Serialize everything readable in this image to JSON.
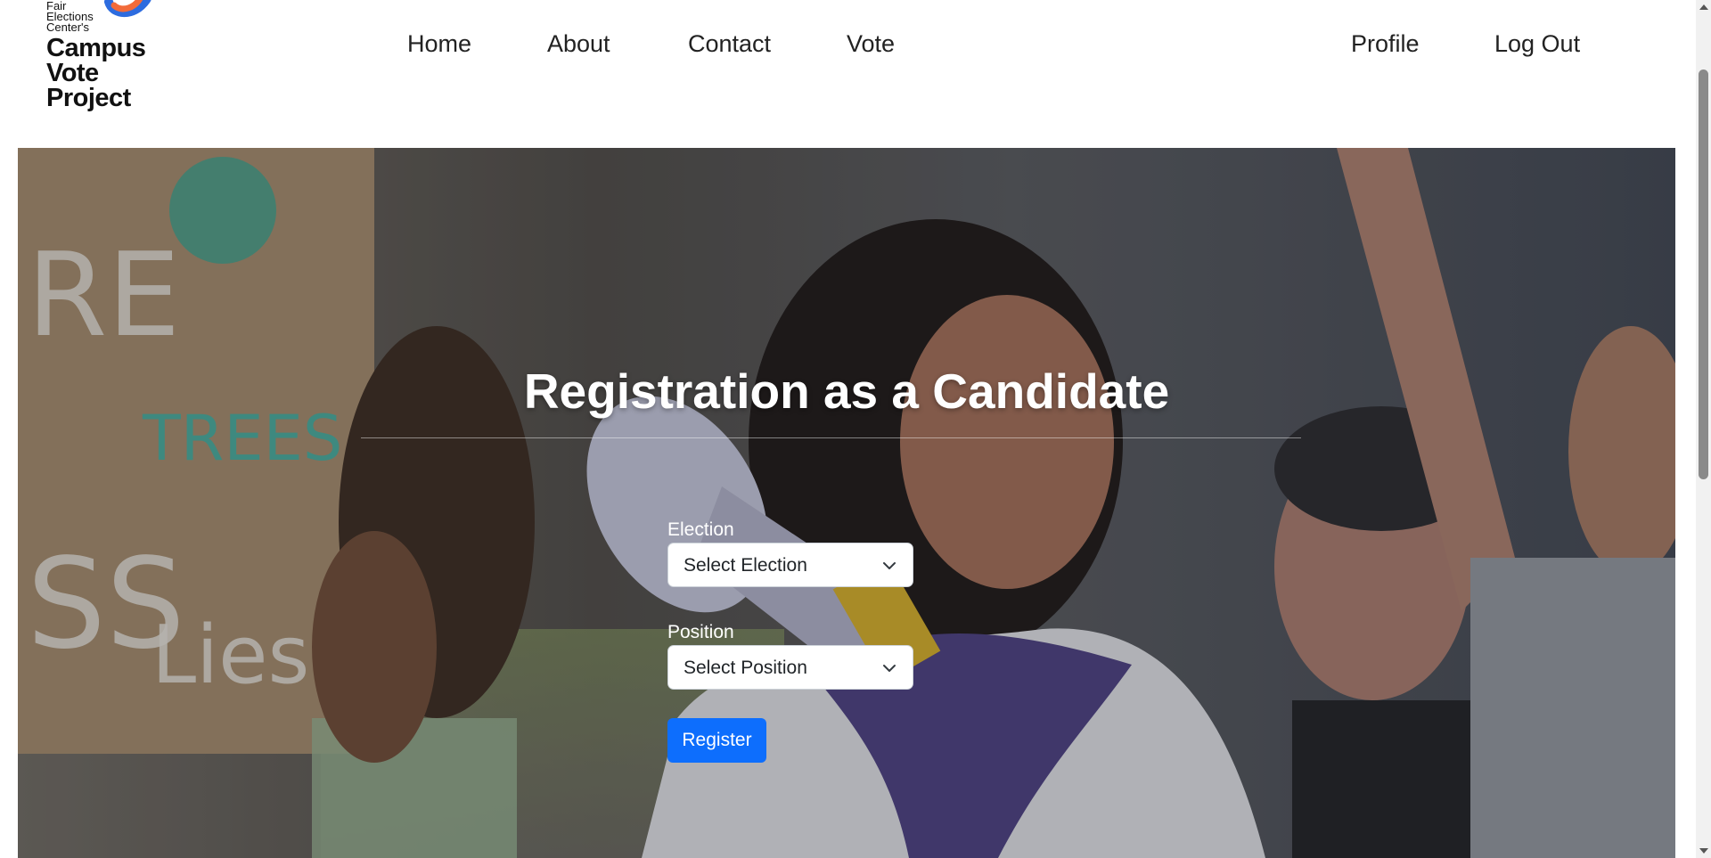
{
  "logo": {
    "line1": "Fair",
    "line2": "Elections",
    "line3": "Center's",
    "line4": "Campus",
    "line5": "Vote",
    "line6": "Project"
  },
  "nav": {
    "home": "Home",
    "about": "About",
    "contact": "Contact",
    "vote": "Vote",
    "profile": "Profile",
    "logout": "Log Out"
  },
  "hero": {
    "title": "Registration as a Candidate"
  },
  "form": {
    "election_label": "Election",
    "election_value": "Select Election",
    "position_label": "Position",
    "position_value": "Select Position",
    "register_label": "Register"
  },
  "colors": {
    "primary_button": "#0d6efd",
    "logo_orange": "#f26b3a",
    "logo_blue": "#2d6cdf"
  }
}
